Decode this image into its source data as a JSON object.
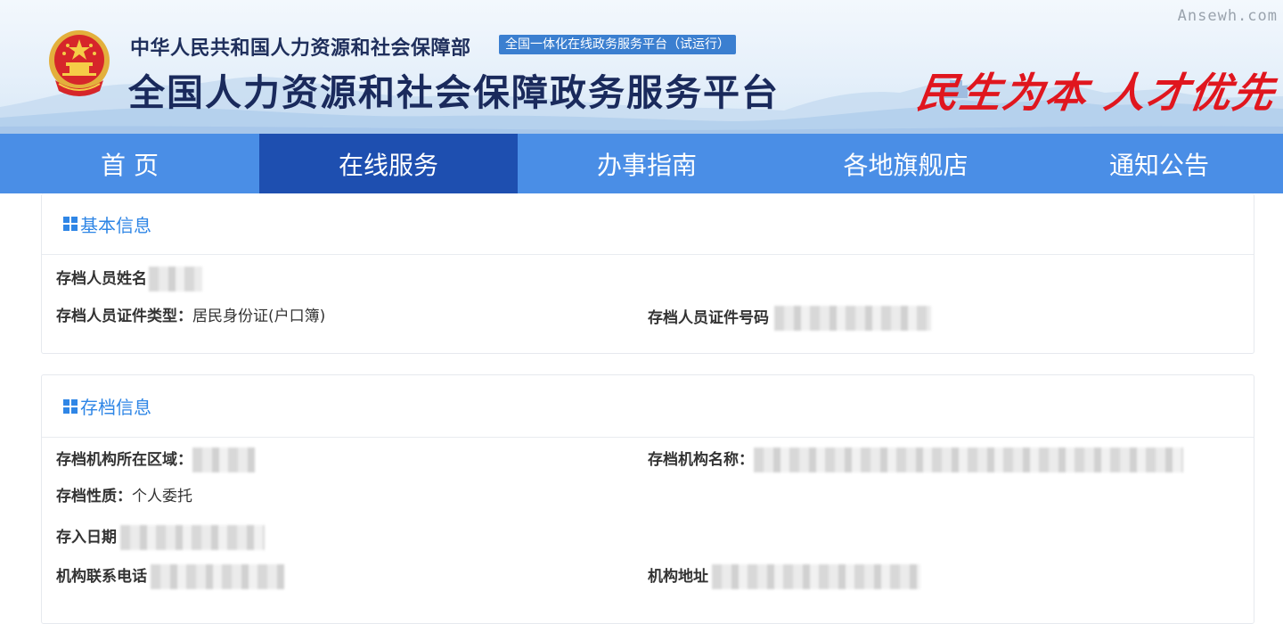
{
  "header": {
    "ministry": "中华人民共和国人力资源和社会保障部",
    "trial_badge": "全国一体化在线政务服务平台（试运行）",
    "platform_title": "全国人力资源和社会保障政务服务平台",
    "slogan": "民生为本 人才优先",
    "watermark": "Ansewh.com"
  },
  "nav": {
    "items": [
      {
        "label": "首 页",
        "active": false
      },
      {
        "label": "在线服务",
        "active": true
      },
      {
        "label": "办事指南",
        "active": false
      },
      {
        "label": "各地旗舰店",
        "active": false
      },
      {
        "label": "通知公告",
        "active": false
      }
    ]
  },
  "basic_info": {
    "title": "基本信息",
    "name_label": "存档人员姓名",
    "id_type_label": "存档人员证件类型：",
    "id_type_value": "居民身份证(户口簿)",
    "id_number_label": "存档人员证件号码"
  },
  "archive_info": {
    "title": "存档信息",
    "region_label": "存档机构所在区域：",
    "org_name_label": "存档机构名称：",
    "nature_label": "存档性质：",
    "nature_value": "个人委托",
    "date_label": "存入日期",
    "phone_label": "机构联系电话",
    "address_label": "机构地址"
  },
  "colors": {
    "nav_bg": "#4a8ee6",
    "nav_active": "#1e4fb0",
    "accent": "#2f86e6",
    "slogan": "#e0161e",
    "badge": "#3b7fd0"
  }
}
